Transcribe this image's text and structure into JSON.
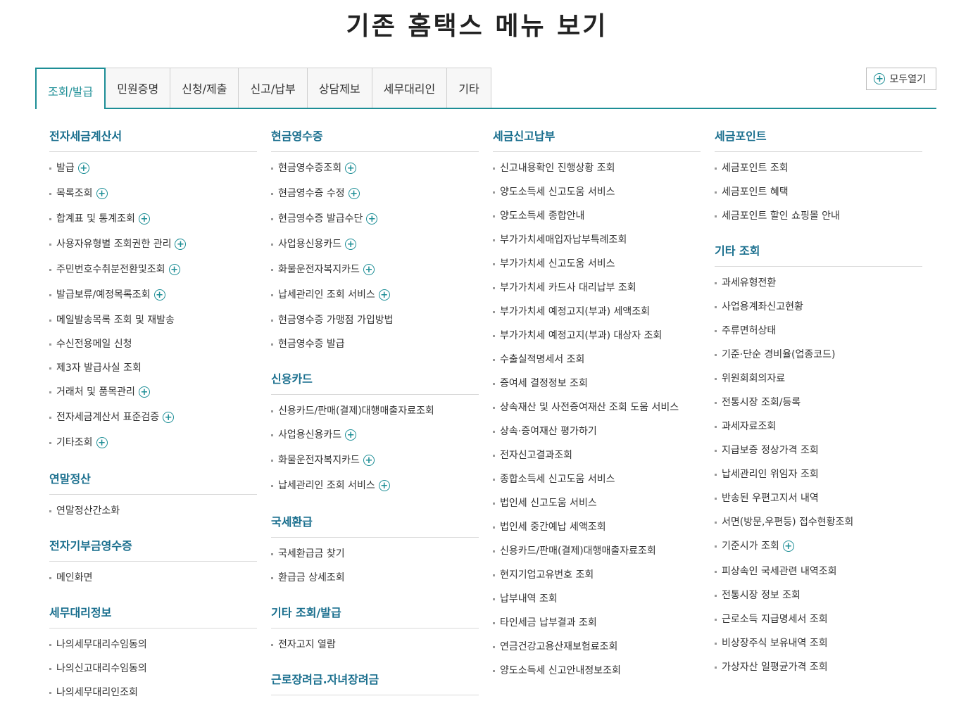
{
  "page": {
    "title": "기존 홈택스 메뉴 보기"
  },
  "tabs": [
    "조회/발급",
    "민원증명",
    "신청/제출",
    "신고/납부",
    "상담제보",
    "세무대리인",
    "기타"
  ],
  "open_all_label": "모두열기",
  "columns": [
    {
      "sections": [
        {
          "title": "전자세금계산서",
          "items": [
            {
              "label": "발급",
              "plus": true
            },
            {
              "label": "목록조회",
              "plus": true
            },
            {
              "label": "합계표 및 통계조회",
              "plus": true
            },
            {
              "label": "사용자유형별 조회권한 관리",
              "plus": true
            },
            {
              "label": "주민번호수취분전환및조회",
              "plus": true
            },
            {
              "label": "발급보류/예정목록조회",
              "plus": true
            },
            {
              "label": "메일발송목록 조회 및 재발송",
              "plus": false
            },
            {
              "label": "수신전용메일 신청",
              "plus": false
            },
            {
              "label": "제3자 발급사실 조회",
              "plus": false
            },
            {
              "label": "거래처 및 품목관리",
              "plus": true
            },
            {
              "label": "전자세금계산서 표준검증",
              "plus": true
            },
            {
              "label": "기타조회",
              "plus": true
            }
          ]
        },
        {
          "title": "연말정산",
          "items": [
            {
              "label": "연말정산간소화",
              "plus": false
            }
          ]
        },
        {
          "title": "전자기부금영수증",
          "items": [
            {
              "label": "메인화면",
              "plus": false
            }
          ]
        },
        {
          "title": "세무대리정보",
          "items": [
            {
              "label": "나의세무대리수임동의",
              "plus": false
            },
            {
              "label": "나의신고대리수임동의",
              "plus": false
            },
            {
              "label": "나의세무대리인조회",
              "plus": false
            }
          ]
        }
      ]
    },
    {
      "sections": [
        {
          "title": "현금영수증",
          "items": [
            {
              "label": "현금영수증조회",
              "plus": true
            },
            {
              "label": "현금영수증 수정",
              "plus": true
            },
            {
              "label": "현금영수증 발급수단",
              "plus": true
            },
            {
              "label": "사업용신용카드",
              "plus": true
            },
            {
              "label": "화물운전자복지카드",
              "plus": true
            },
            {
              "label": "납세관리인 조회 서비스",
              "plus": true
            },
            {
              "label": "현금영수증 가맹점 가입방법",
              "plus": false
            },
            {
              "label": "현금영수증 발급",
              "plus": false
            }
          ]
        },
        {
          "title": "신용카드",
          "items": [
            {
              "label": "신용카드/판매(결제)대행매출자료조회",
              "plus": false
            },
            {
              "label": "사업용신용카드",
              "plus": true
            },
            {
              "label": "화물운전자복지카드",
              "plus": true
            },
            {
              "label": "납세관리인 조회 서비스",
              "plus": true
            }
          ]
        },
        {
          "title": "국세환급",
          "items": [
            {
              "label": "국세환급금 찾기",
              "plus": false
            },
            {
              "label": "환급금 상세조회",
              "plus": false
            }
          ]
        },
        {
          "title": "기타 조회/발급",
          "items": [
            {
              "label": "전자고지 열람",
              "plus": false
            }
          ]
        },
        {
          "title": "근로장려금.자녀장려금",
          "items": []
        }
      ]
    },
    {
      "sections": [
        {
          "title": "세금신고납부",
          "items": [
            {
              "label": "신고내용확인 진행상황 조회",
              "plus": false
            },
            {
              "label": "양도소득세 신고도움 서비스",
              "plus": false
            },
            {
              "label": "양도소득세 종합안내",
              "plus": false
            },
            {
              "label": "부가가치세매입자납부특례조회",
              "plus": false
            },
            {
              "label": "부가가치세 신고도움 서비스",
              "plus": false
            },
            {
              "label": "부가가치세 카드사 대리납부 조회",
              "plus": false
            },
            {
              "label": "부가가치세 예정고지(부과) 세액조회",
              "plus": false
            },
            {
              "label": "부가가치세 예정고지(부과) 대상자 조회",
              "plus": false
            },
            {
              "label": "수출실적명세서 조회",
              "plus": false
            },
            {
              "label": "증여세 결정정보 조회",
              "plus": false
            },
            {
              "label": "상속재산 및 사전증여재산 조회 도움 서비스",
              "plus": false
            },
            {
              "label": "상속·증여재산 평가하기",
              "plus": false
            },
            {
              "label": "전자신고결과조회",
              "plus": false
            },
            {
              "label": "종합소득세 신고도움 서비스",
              "plus": false
            },
            {
              "label": "법인세 신고도움 서비스",
              "plus": false
            },
            {
              "label": "법인세 중간예납 세액조회",
              "plus": false
            },
            {
              "label": "신용카드/판매(결제)대행매출자료조회",
              "plus": false
            },
            {
              "label": "현지기업고유번호 조회",
              "plus": false
            },
            {
              "label": "납부내역 조회",
              "plus": false
            },
            {
              "label": "타인세금 납부결과 조회",
              "plus": false
            },
            {
              "label": "연금건강고용산재보험료조회",
              "plus": false
            },
            {
              "label": "양도소득세 신고안내정보조회",
              "plus": false
            }
          ]
        }
      ]
    },
    {
      "sections": [
        {
          "title": "세금포인트",
          "items": [
            {
              "label": "세금포인트 조회",
              "plus": false
            },
            {
              "label": "세금포인트 혜택",
              "plus": false
            },
            {
              "label": "세금포인트 할인 쇼핑몰 안내",
              "plus": false
            }
          ]
        },
        {
          "title": "기타 조회",
          "items": [
            {
              "label": "과세유형전환",
              "plus": false
            },
            {
              "label": "사업용계좌신고현황",
              "plus": false
            },
            {
              "label": "주류면허상태",
              "plus": false
            },
            {
              "label": "기준·단순 경비율(업종코드)",
              "plus": false
            },
            {
              "label": "위원회회의자료",
              "plus": false
            },
            {
              "label": "전통시장 조회/등록",
              "plus": false
            },
            {
              "label": "과세자료조회",
              "plus": false
            },
            {
              "label": "지급보증 정상가격 조회",
              "plus": false
            },
            {
              "label": "납세관리인 위임자 조회",
              "plus": false
            },
            {
              "label": "반송된 우편고지서 내역",
              "plus": false
            },
            {
              "label": "서면(방문,우편등) 접수현황조회",
              "plus": false
            },
            {
              "label": "기준시가 조회",
              "plus": true
            },
            {
              "label": "피상속인 국세관련 내역조회",
              "plus": false
            },
            {
              "label": "전통시장 정보 조회",
              "plus": false
            },
            {
              "label": "근로소득 지급명세서 조회",
              "plus": false
            },
            {
              "label": "비상장주식 보유내역 조회",
              "plus": false
            },
            {
              "label": "가상자산 일평균가격 조회",
              "plus": false
            }
          ]
        }
      ]
    }
  ],
  "icons": {
    "plus": "plus-circle-icon"
  },
  "colors": {
    "accent": "#1d8e96",
    "section_title": "#1a6f8e"
  }
}
